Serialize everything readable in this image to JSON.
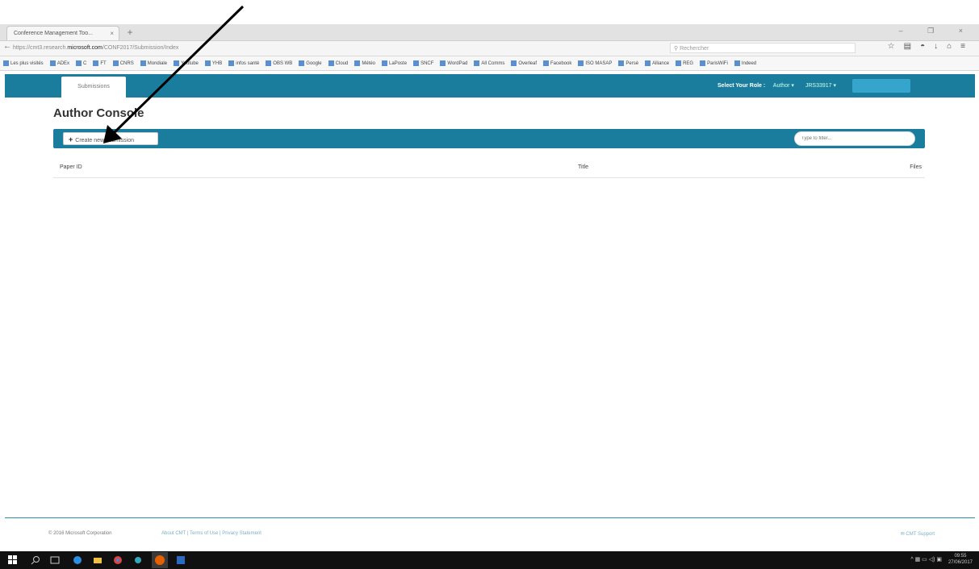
{
  "browser": {
    "tab_title": "Conference Management Too...",
    "tab_close": "×",
    "new_tab": "+",
    "window_controls": "–  ❐  ×",
    "url_prefix": "https://cmt3.research.",
    "url_domain": "microsoft.com",
    "url_suffix": "/CONF2017/Submission/Index",
    "search_placeholder": "Rechercher",
    "bookmarks": [
      "Les plus visités",
      "ADEx",
      "C",
      "FT",
      "CNRS",
      "Mondiale",
      "Youtube",
      "YHB",
      "infos santé",
      "OBS WB",
      "Google",
      "Cloud",
      "Météo",
      "LaPoste",
      "SNCF",
      "WordPad",
      "All Comms",
      "Overleaf",
      "Facebook",
      "ISO MASAP",
      "Persé",
      "Alliance",
      "REG",
      "ParisWiFi",
      "Indeed"
    ]
  },
  "app": {
    "nav_tab": "Submissions",
    "select_role_label": "Select Your Role :",
    "role_value": "Author ▾",
    "user_value": "JRS33917 ▾",
    "page_title": "Author Console",
    "create_button": "Create new submission",
    "create_icon": "+",
    "filter_placeholder": "Type to filter...",
    "table_headers": [
      "Paper ID",
      "Title",
      "Files"
    ]
  },
  "footer": {
    "copyright": "© 2016 Microsoft Corporation",
    "links": "About CMT | Terms of Use | Privacy Statement",
    "support": "CMT Support"
  },
  "taskbar": {
    "clock_time": "09:55",
    "clock_date": "27/06/2017"
  },
  "colors": {
    "accent": "#1a7d9d",
    "user_box": "#35a5cd",
    "taskbar": "#101010"
  }
}
